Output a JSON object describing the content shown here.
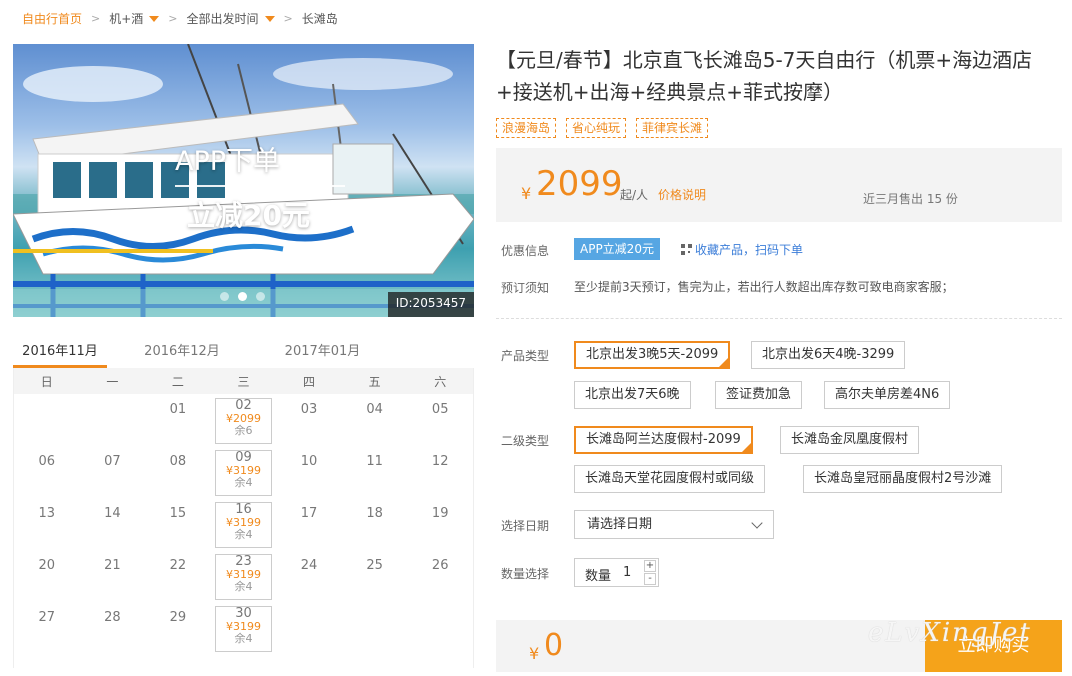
{
  "breadcrumb": {
    "home": "自由行首页",
    "items": [
      {
        "label": "机+酒",
        "dropdown": true
      },
      {
        "label": "全部出发时间",
        "dropdown": true
      },
      {
        "label": "长滩岛",
        "dropdown": false
      }
    ]
  },
  "hero": {
    "promo_line1": "APP下单",
    "promo_line2": "立减20元",
    "id_tag": "ID:2053457",
    "slides_total": 3,
    "slide_active": 2
  },
  "calendar": {
    "tabs": [
      "2016年11月",
      "2016年12月",
      "2017年01月"
    ],
    "active_tab": 0,
    "weekdays": [
      "日",
      "一",
      "二",
      "三",
      "四",
      "五",
      "六"
    ],
    "rows": [
      [
        {
          "d": ""
        },
        {
          "d": ""
        },
        {
          "d": "01"
        },
        {
          "d": "02",
          "price": "¥2099",
          "rest": "余6"
        },
        {
          "d": "03"
        },
        {
          "d": "04"
        },
        {
          "d": "05"
        }
      ],
      [
        {
          "d": "06"
        },
        {
          "d": "07"
        },
        {
          "d": "08"
        },
        {
          "d": "09",
          "price": "¥3199",
          "rest": "余4"
        },
        {
          "d": "10"
        },
        {
          "d": "11"
        },
        {
          "d": "12"
        }
      ],
      [
        {
          "d": "13"
        },
        {
          "d": "14"
        },
        {
          "d": "15"
        },
        {
          "d": "16",
          "price": "¥3199",
          "rest": "余4"
        },
        {
          "d": "17"
        },
        {
          "d": "18"
        },
        {
          "d": "19"
        }
      ],
      [
        {
          "d": "20"
        },
        {
          "d": "21"
        },
        {
          "d": "22"
        },
        {
          "d": "23",
          "price": "¥3199",
          "rest": "余4"
        },
        {
          "d": "24"
        },
        {
          "d": "25"
        },
        {
          "d": "26"
        }
      ],
      [
        {
          "d": "27"
        },
        {
          "d": "28"
        },
        {
          "d": "29"
        },
        {
          "d": "30",
          "price": "¥3199",
          "rest": "余4"
        },
        {
          "d": ""
        },
        {
          "d": ""
        },
        {
          "d": ""
        }
      ]
    ]
  },
  "product": {
    "title": "【元旦/春节】北京直飞长滩岛5-7天自由行（机票+海边酒店+接送机+出海+经典景点+菲式按摩）",
    "tags": [
      "浪漫海岛",
      "省心纯玩",
      "菲律宾长滩"
    ],
    "price": {
      "currency": "¥",
      "amount": "2099",
      "unit": "起/人",
      "explain": "价格说明",
      "sold": "近三月售出 15 份"
    },
    "discount_label": "优惠信息",
    "discount_badge": "APP立减20元",
    "qr_text": "收藏产品，扫码下单",
    "notice_label": "预订须知",
    "notice_text": "至少提前3天预订，售完为止，若出行人数超出库存数可致电商家客服；",
    "type_label": "产品类型",
    "type_options": [
      "北京出发3晚5天-2099",
      "北京出发6天4晚-3299",
      "北京出发7天6晚",
      "签证费加急",
      "高尔夫单房差4N6"
    ],
    "type_selected": 0,
    "subtype_label": "二级类型",
    "subtype_options": [
      "长滩岛阿兰达度假村-2099",
      "长滩岛金凤凰度假村",
      "长滩岛天堂花园度假村或同级",
      "长滩岛皇冠丽晶度假村2号沙滩"
    ],
    "subtype_selected": 0,
    "date_label": "选择日期",
    "date_placeholder": "请选择日期",
    "qty_label": "数量选择",
    "qty_inner_label": "数量",
    "qty_value": "1",
    "plus": "+",
    "minus": "-",
    "total_currency": "¥",
    "total": "0",
    "buy_label": "立即购买",
    "watermark": "eLvXingJet"
  },
  "colors": {
    "accent": "#f08a1d",
    "badge_blue": "#56a6e3",
    "buy_button": "#f5a31a"
  }
}
